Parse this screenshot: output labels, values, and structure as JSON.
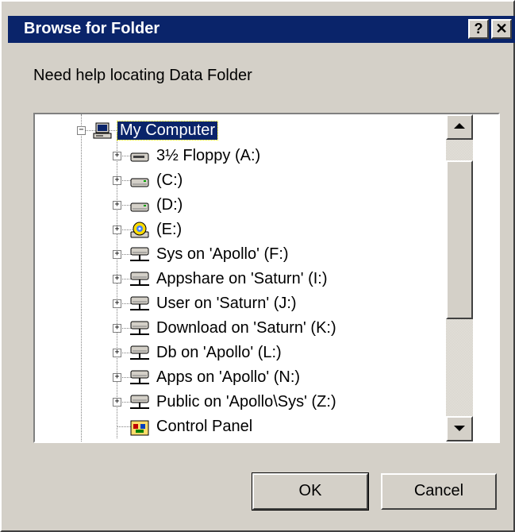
{
  "window": {
    "title": "Browse for Folder",
    "help_label": "?",
    "close_label": "✕",
    "title_bar_color": "#0a246a",
    "face_color": "#d4d0c8"
  },
  "prompt": "Need help locating Data Folder",
  "tree": {
    "root": {
      "label": "My Computer",
      "expander": "−",
      "icon": "computer-icon",
      "selected": true
    },
    "items": [
      {
        "label": "3½ Floppy (A:)",
        "icon": "floppy-drive-icon",
        "expander": "+",
        "name": "floppy-a"
      },
      {
        "label": "(C:)",
        "icon": "hard-drive-icon",
        "expander": "+",
        "name": "drive-c"
      },
      {
        "label": "(D:)",
        "icon": "hard-drive-icon",
        "expander": "+",
        "name": "drive-d"
      },
      {
        "label": "(E:)",
        "icon": "cd-drive-icon",
        "expander": "+",
        "name": "drive-e"
      },
      {
        "label": "Sys on 'Apollo' (F:)",
        "icon": "network-drive-icon",
        "expander": "+",
        "name": "drive-f"
      },
      {
        "label": "Appshare on 'Saturn' (I:)",
        "icon": "network-drive-icon",
        "expander": "+",
        "name": "drive-i"
      },
      {
        "label": "User on 'Saturn' (J:)",
        "icon": "network-drive-icon",
        "expander": "+",
        "name": "drive-j"
      },
      {
        "label": "Download on 'Saturn' (K:)",
        "icon": "network-drive-icon",
        "expander": "+",
        "name": "drive-k"
      },
      {
        "label": "Db on 'Apollo' (L:)",
        "icon": "network-drive-icon",
        "expander": "+",
        "name": "drive-l"
      },
      {
        "label": "Apps on 'Apollo' (N:)",
        "icon": "network-drive-icon",
        "expander": "+",
        "name": "drive-n"
      },
      {
        "label": "Public on 'Apollo\\Sys' (Z:)",
        "icon": "network-drive-icon",
        "expander": "+",
        "name": "drive-z"
      },
      {
        "label": "Control Panel",
        "icon": "control-panel-icon",
        "expander": "",
        "name": "control-panel"
      }
    ]
  },
  "buttons": {
    "ok": "OK",
    "cancel": "Cancel"
  }
}
